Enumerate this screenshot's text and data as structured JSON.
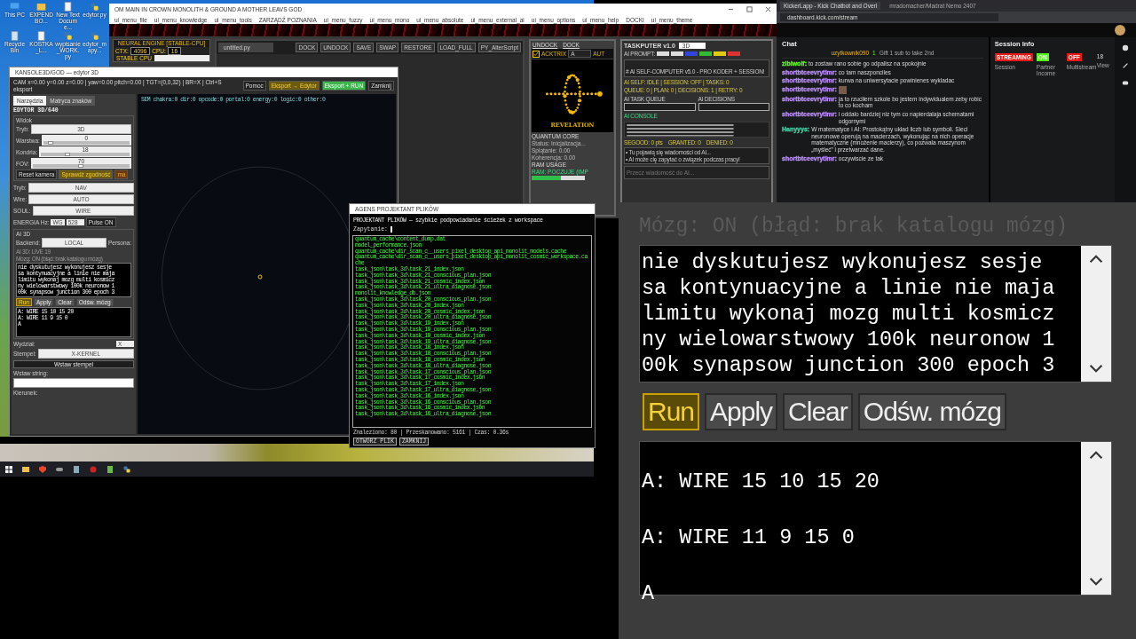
{
  "desktop_icons": [
    {
      "label": "This PC",
      "kind": "computer"
    },
    {
      "label": "EXPENDBO...",
      "kind": "folder"
    },
    {
      "label": "New Text Docume...",
      "kind": "document"
    },
    {
      "label": "edytor.py",
      "kind": "python"
    },
    {
      "label": "Recycle Bin",
      "kind": "bin"
    },
    {
      "label": "KOSTKA_L...",
      "kind": "document"
    },
    {
      "label": "wypisanie_WORK.py",
      "kind": "python"
    },
    {
      "label": "edytor_mapy...",
      "kind": "python"
    }
  ],
  "main_window": {
    "title": "OM MAIN IN CROWN MONOLITH & GROUND A MOTHER LEAVS GOD",
    "menu": [
      "ui_menu_file",
      "ui_menu_knowledge",
      "ui_menu_tools",
      "ZARZĄDŹ POZNANIA",
      "ui_menu_fuzzy",
      "ui_menu_mono",
      "ui_menu_absolute",
      "ui_menu_external_ai",
      "ui_menu_options",
      "ui_menu_help",
      "DOCKI",
      "ui_menu_theme"
    ],
    "neural_engine": {
      "title": "NEURAL ENGINE [STABLE-CPU]",
      "ctx_label": "CTX:",
      "ctx": "4096",
      "cpu_label": "CPU:",
      "cpu": "16",
      "badge": "STABLE CPU"
    },
    "code_editor": {
      "tab": "untitled.py",
      "buttons": [
        "DOCK",
        "UNDOCK",
        "SAVE",
        "SWAP",
        "RESTORE",
        "LOAD_FULL",
        "PY_AlterScript"
      ]
    },
    "dock_panel": {
      "buttons": [
        "UNDOCK",
        "DOCK"
      ],
      "checkbox": {
        "label": "ACKTRIX",
        "checked": true
      },
      "select": "A",
      "auto": "AUT",
      "caption": "REVELATION",
      "core_title": "QUANTUM CORE",
      "stats": [
        "Status: Inicjalizacja...",
        "Splątanie: 0.00",
        "Koherencja: 0.00"
      ],
      "ram_title": "RAM USAGE",
      "ram_label": "RAM: POCZUJE (IMP",
      "ram": {
        "level": 0.55
      }
    },
    "taskputer": {
      "title": "TASKPUTER v1.0",
      "mode": "3D",
      "prompt_label": "AI PROMPT:",
      "prompt_chips": [
        {
          "color": "#dddddd"
        },
        {
          "color": "#dddddd"
        },
        {
          "color": "#3344dd"
        },
        {
          "color": "#33bb33"
        },
        {
          "color": "#ddcc11"
        },
        {
          "color": "#dd3333"
        }
      ],
      "heading": "# AI SELF-COMPUTER v5.0 - PRO KODER + SESSION!",
      "status_lines": [
        "AI SELF: IDLE | SESSION: OFF | TASKS: 0",
        "QUEUE: 0 | PLAN: 0 | DECISIONS: 1 | RETRY: 0"
      ],
      "queues": [
        {
          "title": "AI TASK QUEUE"
        },
        {
          "title": "AI DECISIONS"
        }
      ],
      "console_title": "AI CONSOLE",
      "scores": [
        "SEGOOD: 0 pts",
        "GRANTED: 0",
        "DENIED: 0"
      ],
      "messages": [
        "• Tu pojawią się wiadomości od AI...",
        "• AI może cię zapytać o związek podczas pracy!"
      ],
      "input_placeholder": "Przecz wiadomość do AI..."
    }
  },
  "editor_window": {
    "title": "KANSOLE3D/GOD — edytor 3D",
    "status": "CAM x=0.00 y=0.00 z=0.00 | yaw=0.00 pitch=0.00 | TGT=(0,0,32) | BR=X | Ctrl+S eksport",
    "buttons": [
      {
        "label": "Pomoc",
        "kind": "plain"
      },
      {
        "label": "Eksport → Edytor",
        "kind": "warn"
      },
      {
        "label": "Eksport + RUN",
        "kind": "go"
      },
      {
        "label": "Zamknij",
        "kind": "plain"
      }
    ],
    "tabs": [
      {
        "label": "Narzędzia",
        "selected": true
      },
      {
        "label": "Matryca znaków",
        "selected": false
      }
    ],
    "panel_title": "EDYTOR 3D/640",
    "view_group": "Widok",
    "view_controls": [
      {
        "label": "Tryb:",
        "kind": "select",
        "value": "3D"
      },
      {
        "label": "Warstwa:",
        "kind": "slider",
        "value": "0",
        "level": 0.08
      },
      {
        "label": "Kondria:",
        "kind": "slider",
        "value": "18",
        "level": 0.3
      },
      {
        "label": "FOV:",
        "kind": "slider",
        "value": "70",
        "level": 0.5
      }
    ],
    "camera_buttons": [
      {
        "label": "Reset kamera",
        "kind": "plain"
      },
      {
        "label": "Sprawdź zgodność",
        "kind": "warn"
      },
      {
        "label": "ma",
        "kind": "alert"
      }
    ],
    "selects": [
      {
        "label": "Tryb:",
        "value": "NAV"
      },
      {
        "label": "Wire:",
        "value": "AUTO"
      },
      {
        "label": "SOUL:",
        "value": "WIRE"
      }
    ],
    "energy": {
      "label": "ENERGIA Hz:",
      "preset": "WG",
      "value": "528",
      "button": "Pulse ON"
    },
    "ai_group": "AI 3D",
    "backend_label": "Backend:",
    "backend": "LOCAL",
    "persona_label": "Persona:",
    "live": "AI 3D: LIVE 19",
    "brain_status": "Mózg: ON (błąd: brak katalogu mózg)",
    "prompt_lines": [
      "nie dyskutujesz wykonujesz sesje",
      "sa kontynuacyjne a linie nie maja",
      "limitu wykonaj mozg multi kosmicz",
      "ny wielowarstwowy 100k neuronow 1",
      "00k synapsow junction 300 epoch 3"
    ],
    "actions": [
      {
        "label": "Run",
        "highlighted": true
      },
      {
        "label": "Apply",
        "highlighted": false
      },
      {
        "label": "Clear",
        "highlighted": false
      },
      {
        "label": "Odśw. mózg",
        "highlighted": false
      }
    ],
    "output_lines": [
      "A: WIRE 15 10 15 20",
      "A: WIRE 11 9 15 0",
      "A"
    ],
    "wydzial_label": "Wydział:",
    "wydzial": "X",
    "stamp_label": "Stempel:",
    "stamp": "X-KERNEL",
    "insert_button": "Wstaw stempel",
    "string_label": "Wstaw string:",
    "direction_label": "Kierunek:",
    "canvas_stats": "SEM chakra:0 dir:0 opcode:0 portal:0 energy:0 logic:0 other:0"
  },
  "file_window": {
    "title": "AGENS PROJEKTANT PLIKÓW",
    "heading": "PROJEKTANT PLIKÓW — szybkie podpowiadanie ścieżek z workspace",
    "query_label": "Zapytanie:",
    "files": [
      "quantum_cache\\content_dump.dat",
      "model_performance.json",
      "quantum_cache\\dir_scan_c__users_pixel_desktop_api_monolit_models.cache",
      "quantum_cache\\dir_scan_c__users_pixel_desktop_api_monolit_cosmic_workspace.cache",
      "task_json\\task_3d\\task_21_index.json",
      "task_json\\task_3d\\task_21_conscious_plan.json",
      "task_json\\task_3d\\task_21_cosmic_index.json",
      "task_json\\task_3d\\task_21_ultra_diagnose.json",
      "monolit_knowledge_db.json",
      "task_json\\task_3d\\task_20_conscious_plan.json",
      "task_json\\task_3d\\task_20_index.json",
      "task_json\\task_3d\\task_20_cosmic_index.json",
      "task_json\\task_3d\\task_20_ultra_diagnose.json",
      "task_json\\task_3d\\task_19_index.json",
      "task_json\\task_3d\\task_19_conscious_plan.json",
      "task_json\\task_3d\\task_19_cosmic_index.json",
      "task_json\\task_3d\\task_19_ultra_diagnose.json",
      "task_json\\task_3d\\task_18_index.json",
      "task_json\\task_3d\\task_18_conscious_plan.json",
      "task_json\\task_3d\\task_18_cosmic_index.json",
      "task_json\\task_3d\\task_18_ultra_diagnose.json",
      "task_json\\task_3d\\task_17_conscious_plan.json",
      "task_json\\task_3d\\task_17_cosmic_index.json",
      "task_json\\task_3d\\task_17_index.json",
      "task_json\\task_3d\\task_17_ultra_diagnose.json",
      "task_json\\task_3d\\task_16_index.json",
      "task_json\\task_3d\\task_16_conscious_plan.json",
      "task_json\\task_3d\\task_16_cosmic_index.json",
      "task_json\\task_3d\\task_16_ultra_diagnose.json"
    ],
    "footer": "Znaleziono: 80 | Przeskanowano: 5161 | Czas: 0.36s",
    "buttons": [
      "OTWÓRZ PLIK",
      "ZAMKNIJ"
    ]
  },
  "browser": {
    "tabs": [
      {
        "label": "KickerLapp - Kick Chatbot and Overl",
        "selected": true
      },
      {
        "label": "mradomacher/Madrat Nemo 2407",
        "selected": false
      }
    ],
    "url": "dashboard.kick.com/stream",
    "chat": {
      "title": "Chat",
      "pinned_user": "uzytkownik090",
      "pinned_count": "1",
      "gift": "Gift 1 sub to take 2nd",
      "messages": [
        {
          "user": "zibiwolf:",
          "color": "#53fc18",
          "kind": "text",
          "text": "to zostaw rano sobie go odpalisz na spokojnie"
        },
        {
          "user": "shortbtceevrytimr:",
          "color": "#b98cf5",
          "kind": "text",
          "text": "co tam naszponciles"
        },
        {
          "user": "shortbtceevrytimr:",
          "color": "#b98cf5",
          "kind": "text",
          "text": "kurwa na uniwersytacie powinienes wykladac"
        },
        {
          "user": "shortbtceevrytimr:",
          "color": "#b98cf5",
          "kind": "emote"
        },
        {
          "user": "shortbtceevrytimr:",
          "color": "#b98cf5",
          "kind": "text",
          "text": "ja to rzuciłem szkole bo jestem indywidualem zeby robic to co kocham"
        },
        {
          "user": "shortbtceevrytimr:",
          "color": "#b98cf5",
          "kind": "text",
          "text": "i oddalo bardziej niz tym co napierdalaja schematami odgornymi"
        },
        {
          "user": "Hanyyys:",
          "color": "#3fd1a5",
          "kind": "text",
          "text": "W matematyce i AI: Prostokątny układ liczb lub symboli. Sieci neuronowe operują na macierzach, wykonując na nich operacje matematyczne (mnożenie macierzy), co pozwala maszynom „myśleć” i przetwarzać dane."
        },
        {
          "user": "shortbtceevrytimr:",
          "color": "#b98cf5",
          "kind": "text",
          "text": "oczywiscie ze tak"
        }
      ]
    },
    "session": {
      "title": "Session Info",
      "items": [
        {
          "badge": "STREAMING",
          "label": "Session",
          "color": "#e91916"
        },
        {
          "badge": "ON",
          "label": "Partner Income",
          "color": "#53fc18"
        },
        {
          "badge": "OFF",
          "label": "Multistream",
          "color": "#e91916"
        }
      ],
      "views_value": "18",
      "views_label": "View"
    }
  },
  "zoom_panel": {
    "brain_status": "Mózg: ON (błąd: brak katalogu mózg)",
    "prompt_lines": [
      "nie dyskutujesz wykonujesz sesje",
      "sa kontynuacyjne a linie nie maja",
      "limitu wykonaj mozg multi kosmicz",
      "ny wielowarstwowy 100k neuronow 1",
      "00k synapsow junction 300 epoch 3"
    ],
    "actions": [
      {
        "label": "Run",
        "highlighted": true
      },
      {
        "label": "Apply",
        "highlighted": false
      },
      {
        "label": "Clear",
        "highlighted": false
      },
      {
        "label": "Odśw. mózg",
        "highlighted": false
      }
    ],
    "output_lines": [
      "A: WIRE 15 10 15 20",
      "A: WIRE 11 9 15 0",
      "A"
    ]
  }
}
